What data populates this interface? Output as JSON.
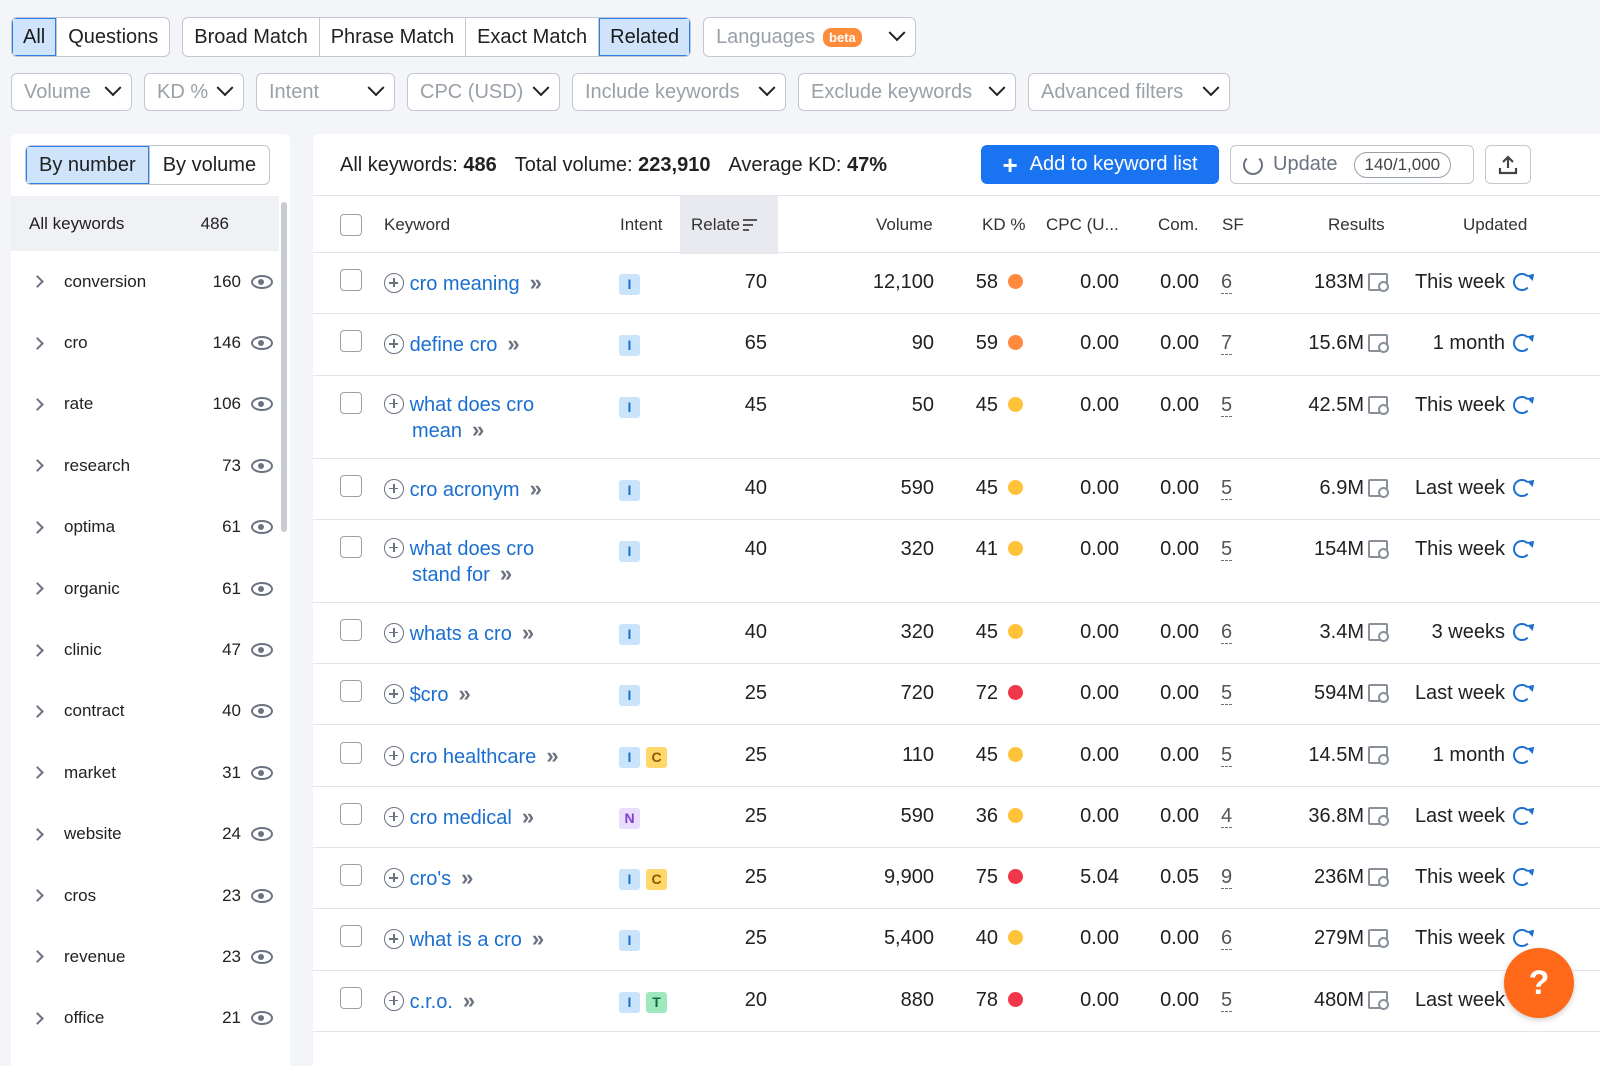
{
  "tabs": {
    "group1": [
      "All",
      "Questions"
    ],
    "group2": [
      "Broad Match",
      "Phrase Match",
      "Exact Match",
      "Related"
    ],
    "languages": "Languages",
    "beta": "beta"
  },
  "filters": [
    "Volume",
    "KD %",
    "Intent",
    "CPC (USD)",
    "Include keywords",
    "Exclude keywords",
    "Advanced filters"
  ],
  "left": {
    "toggle": [
      "By number",
      "By volume"
    ],
    "all_label": "All keywords",
    "all_count": "486",
    "groups": [
      {
        "label": "conversion",
        "count": "160"
      },
      {
        "label": "cro",
        "count": "146"
      },
      {
        "label": "rate",
        "count": "106"
      },
      {
        "label": "research",
        "count": "73"
      },
      {
        "label": "optima",
        "count": "61"
      },
      {
        "label": "organic",
        "count": "61"
      },
      {
        "label": "clinic",
        "count": "47"
      },
      {
        "label": "contract",
        "count": "40"
      },
      {
        "label": "market",
        "count": "31"
      },
      {
        "label": "website",
        "count": "24"
      },
      {
        "label": "cros",
        "count": "23"
      },
      {
        "label": "revenue",
        "count": "23"
      },
      {
        "label": "office",
        "count": "21"
      }
    ]
  },
  "summary": {
    "all_label": "All keywords:",
    "all_value": "486",
    "vol_label": "Total volume:",
    "vol_value": "223,910",
    "kd_label": "Average KD:",
    "kd_value": "47%"
  },
  "actions": {
    "add": "Add to keyword list",
    "update": "Update",
    "quota": "140/1,000"
  },
  "columns": [
    "Keyword",
    "Intent",
    "Relate",
    "Volume",
    "KD %",
    "CPC (U...",
    "Com.",
    "SF",
    "Results",
    "Updated"
  ],
  "colors": {
    "accent": "#1a73f0",
    "orange": "#ff8a3d",
    "yellow": "#ffc33a",
    "red": "#f0384a"
  },
  "rows": [
    {
      "kw": [
        "cro meaning"
      ],
      "intent": [
        "I"
      ],
      "rel": "70",
      "vol": "12,100",
      "kd": "58",
      "kdc": "orange",
      "cpc": "0.00",
      "com": "0.00",
      "sf": "6",
      "res": "183M",
      "upd": "This week"
    },
    {
      "kw": [
        "define cro"
      ],
      "intent": [
        "I"
      ],
      "rel": "65",
      "vol": "90",
      "kd": "59",
      "kdc": "orange",
      "cpc": "0.00",
      "com": "0.00",
      "sf": "7",
      "res": "15.6M",
      "upd": "1 month"
    },
    {
      "kw": [
        "what does cro",
        "mean"
      ],
      "intent": [
        "I"
      ],
      "rel": "45",
      "vol": "50",
      "kd": "45",
      "kdc": "yellow",
      "cpc": "0.00",
      "com": "0.00",
      "sf": "5",
      "res": "42.5M",
      "upd": "This week"
    },
    {
      "kw": [
        "cro acronym"
      ],
      "intent": [
        "I"
      ],
      "rel": "40",
      "vol": "590",
      "kd": "45",
      "kdc": "yellow",
      "cpc": "0.00",
      "com": "0.00",
      "sf": "5",
      "res": "6.9M",
      "upd": "Last week"
    },
    {
      "kw": [
        "what does cro",
        "stand for"
      ],
      "intent": [
        "I"
      ],
      "rel": "40",
      "vol": "320",
      "kd": "41",
      "kdc": "yellow",
      "cpc": "0.00",
      "com": "0.00",
      "sf": "5",
      "res": "154M",
      "upd": "This week"
    },
    {
      "kw": [
        "whats a cro"
      ],
      "intent": [
        "I"
      ],
      "rel": "40",
      "vol": "320",
      "kd": "45",
      "kdc": "yellow",
      "cpc": "0.00",
      "com": "0.00",
      "sf": "6",
      "res": "3.4M",
      "upd": "3 weeks"
    },
    {
      "kw": [
        "$cro"
      ],
      "intent": [
        "I"
      ],
      "rel": "25",
      "vol": "720",
      "kd": "72",
      "kdc": "red",
      "cpc": "0.00",
      "com": "0.00",
      "sf": "5",
      "res": "594M",
      "upd": "Last week"
    },
    {
      "kw": [
        "cro healthcare"
      ],
      "intent": [
        "I",
        "C"
      ],
      "rel": "25",
      "vol": "110",
      "kd": "45",
      "kdc": "yellow",
      "cpc": "0.00",
      "com": "0.00",
      "sf": "5",
      "res": "14.5M",
      "upd": "1 month"
    },
    {
      "kw": [
        "cro medical"
      ],
      "intent": [
        "N"
      ],
      "rel": "25",
      "vol": "590",
      "kd": "36",
      "kdc": "yellow",
      "cpc": "0.00",
      "com": "0.00",
      "sf": "4",
      "res": "36.8M",
      "upd": "Last week"
    },
    {
      "kw": [
        "cro's"
      ],
      "intent": [
        "I",
        "C"
      ],
      "rel": "25",
      "vol": "9,900",
      "kd": "75",
      "kdc": "red",
      "cpc": "5.04",
      "com": "0.05",
      "sf": "9",
      "res": "236M",
      "upd": "This week"
    },
    {
      "kw": [
        "what is a cro"
      ],
      "intent": [
        "I"
      ],
      "rel": "25",
      "vol": "5,400",
      "kd": "40",
      "kdc": "yellow",
      "cpc": "0.00",
      "com": "0.00",
      "sf": "6",
      "res": "279M",
      "upd": "This week"
    },
    {
      "kw": [
        "c.r.o."
      ],
      "intent": [
        "I",
        "T"
      ],
      "rel": "20",
      "vol": "880",
      "kd": "78",
      "kdc": "red",
      "cpc": "0.00",
      "com": "0.00",
      "sf": "5",
      "res": "480M",
      "upd": "Last week"
    }
  ],
  "help": "?"
}
